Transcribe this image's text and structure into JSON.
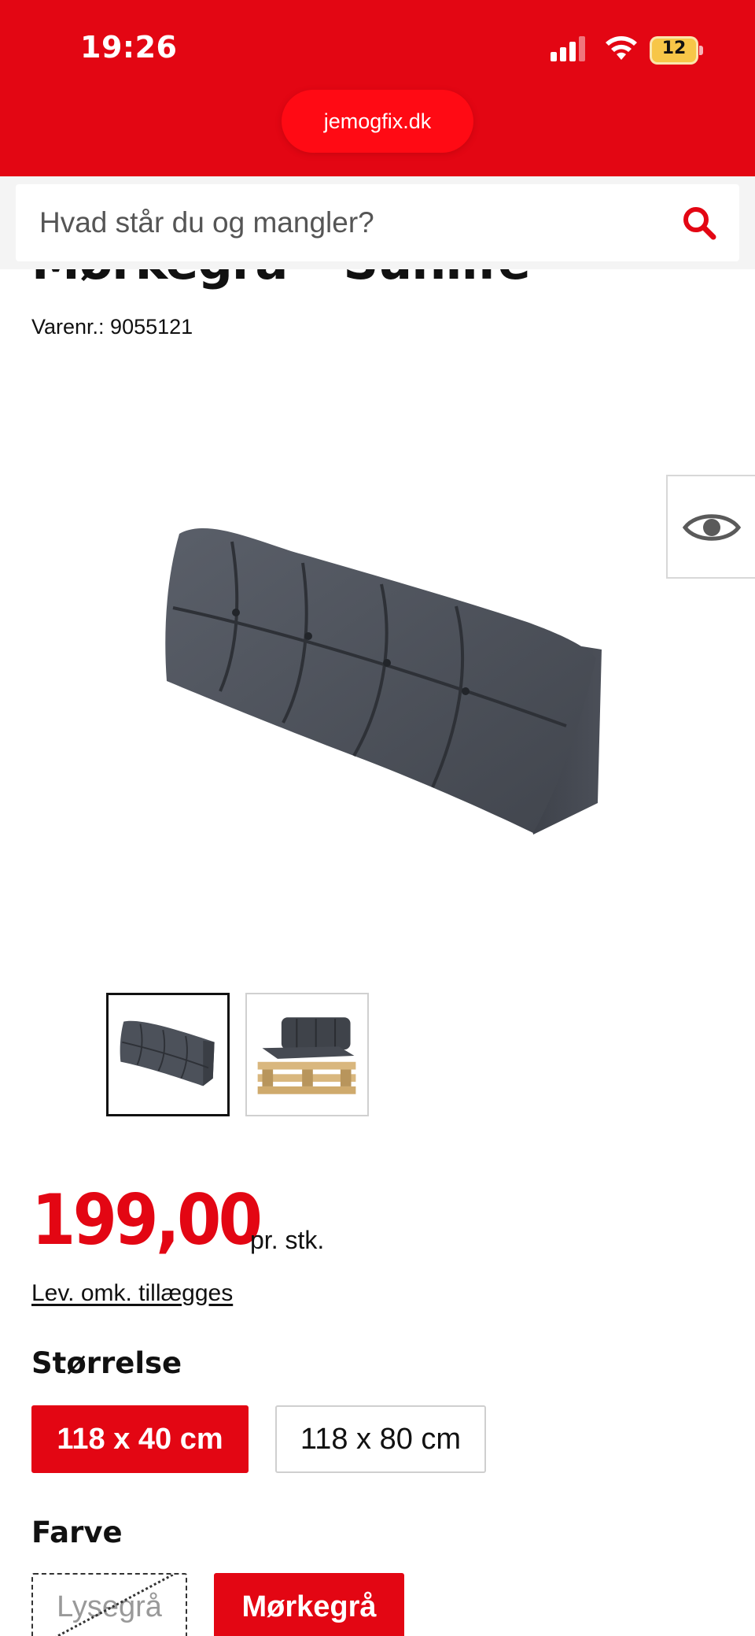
{
  "status_bar": {
    "time": "19:26",
    "battery": "12"
  },
  "browser": {
    "url": "jemogfix.dk"
  },
  "search": {
    "placeholder": "Hvad står du og mangler?"
  },
  "product": {
    "title_partial": "Mørkegrå – Sunlife",
    "sku": "Varenr.: 9055121",
    "price": "199,00",
    "price_unit": "pr. stk.",
    "shipping_link": "Lev. omk. tillægges"
  },
  "size": {
    "label": "Størrelse",
    "options": [
      "118 x 40 cm",
      "118 x 80 cm"
    ],
    "selected": "118 x 40 cm"
  },
  "color": {
    "label": "Farve",
    "options": [
      "Lysegrå",
      "Mørkegrå"
    ],
    "selected": "Mørkegrå",
    "unavailable": [
      "Lysegrå"
    ]
  },
  "colors": {
    "brand_red": "#e30613",
    "cushion": "#4a4f58"
  },
  "icons": [
    "signal-icon",
    "wifi-icon",
    "battery-icon",
    "search-icon",
    "eye-icon"
  ]
}
